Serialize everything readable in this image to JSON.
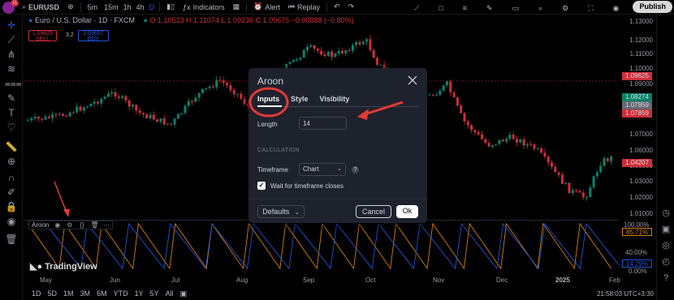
{
  "topbar": {
    "avatar_badge": "11",
    "symbol": "EURUSD",
    "timeframes": [
      "5m",
      "15m",
      "1h",
      "4h",
      "D"
    ],
    "indicators_label": "Indicators",
    "alert_label": "Alert",
    "replay_label": "Replay",
    "publish_label": "Publish"
  },
  "legend": {
    "title": "Euro / U.S. Dollar · 1D · FXCM",
    "ohlc": "O 1.10513 H 1.11074 L 1.09236 C 1.09675 −0.00888 (−0.80%)",
    "sell_price": "1.09625",
    "sell_label": "SELL",
    "spread": "3.2",
    "buy_price": "1.09657",
    "buy_label": "BUY"
  },
  "price_axis": {
    "labels": [
      "1.13000",
      "1.12000",
      "1.11000",
      "1.10000",
      "1.09000",
      "1.07000",
      "1.06000",
      "1.05000",
      "1.03000",
      "1.02000",
      "1.01000"
    ],
    "tags": [
      {
        "text": "1.09625",
        "color": "#f23645"
      },
      {
        "text": "1.08274",
        "color": "#089981"
      },
      {
        "text": "1.07959",
        "color": "#787b86"
      },
      {
        "text": "1.07859",
        "color": "#f23645"
      },
      {
        "text": "1.04207",
        "color": "#f23645"
      }
    ]
  },
  "indicator": {
    "name": "Aroon",
    "labels": [
      "100.00%",
      "40.00%",
      "0.00%"
    ],
    "tags": [
      {
        "text": "85.71%",
        "color": "#ff9800"
      },
      {
        "text": "14.29%",
        "color": "#2962ff"
      }
    ]
  },
  "time_axis": [
    "May",
    "Jun",
    "Jul",
    "Aug",
    "Sep",
    "Oct",
    "Nov",
    "Dec",
    "2025",
    "Feb"
  ],
  "bottom": {
    "ranges": [
      "1D",
      "5D",
      "1M",
      "3M",
      "6M",
      "YTD",
      "1Y",
      "5Y",
      "All"
    ],
    "clock": "21:58:03 UTC+3:30"
  },
  "watermark": "TradingView",
  "dialog": {
    "title": "Aroon",
    "tabs": [
      "Inputs",
      "Style",
      "Visibility"
    ],
    "length_label": "Length",
    "length_value": "14",
    "section_label": "CALCULATION",
    "timeframe_label": "Timeframe",
    "timeframe_value": "Chart",
    "checkbox_label": "Wait for timeframe closes",
    "checkbox_checked": true,
    "defaults_label": "Defaults",
    "cancel_label": "Cancel",
    "ok_label": "Ok"
  },
  "colors": {
    "up": "#089981",
    "down": "#f23645",
    "aroon_up": "#ff9800",
    "aroon_down": "#2962ff",
    "annotation": "#e53935"
  }
}
